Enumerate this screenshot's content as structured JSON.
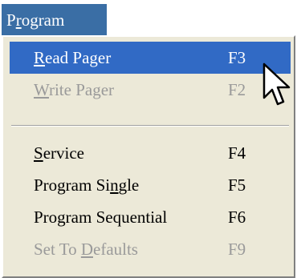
{
  "menubar": {
    "title_first": "P",
    "title_mnemonic": "r",
    "title_rest": "ogram"
  },
  "menu": {
    "items": [
      {
        "pre": "",
        "mnemonic": "R",
        "post": "ead Pager",
        "shortcut": "F3",
        "state": "highlighted"
      },
      {
        "pre": "",
        "mnemonic": "W",
        "post": "rite Pager",
        "shortcut": "F2",
        "state": "disabled"
      },
      {
        "pre": "",
        "mnemonic": "S",
        "post": "ervice",
        "shortcut": "F4",
        "state": "enabled"
      },
      {
        "pre": "Program Si",
        "mnemonic": "n",
        "post": "gle",
        "shortcut": "F5",
        "state": "enabled"
      },
      {
        "pre": "Program Sequential",
        "mnemonic": "",
        "post": "",
        "shortcut": "F6",
        "state": "enabled"
      },
      {
        "pre": "Set To ",
        "mnemonic": "D",
        "post": "efaults",
        "shortcut": "F9",
        "state": "disabled"
      }
    ]
  },
  "colors": {
    "menubar_bg": "#3a6ea5",
    "highlight_bg": "#316ac5",
    "menu_bg": "#ece9d8",
    "disabled_text": "#9a9a9a"
  },
  "icons": {
    "cursor": "arrow-cursor-icon"
  }
}
